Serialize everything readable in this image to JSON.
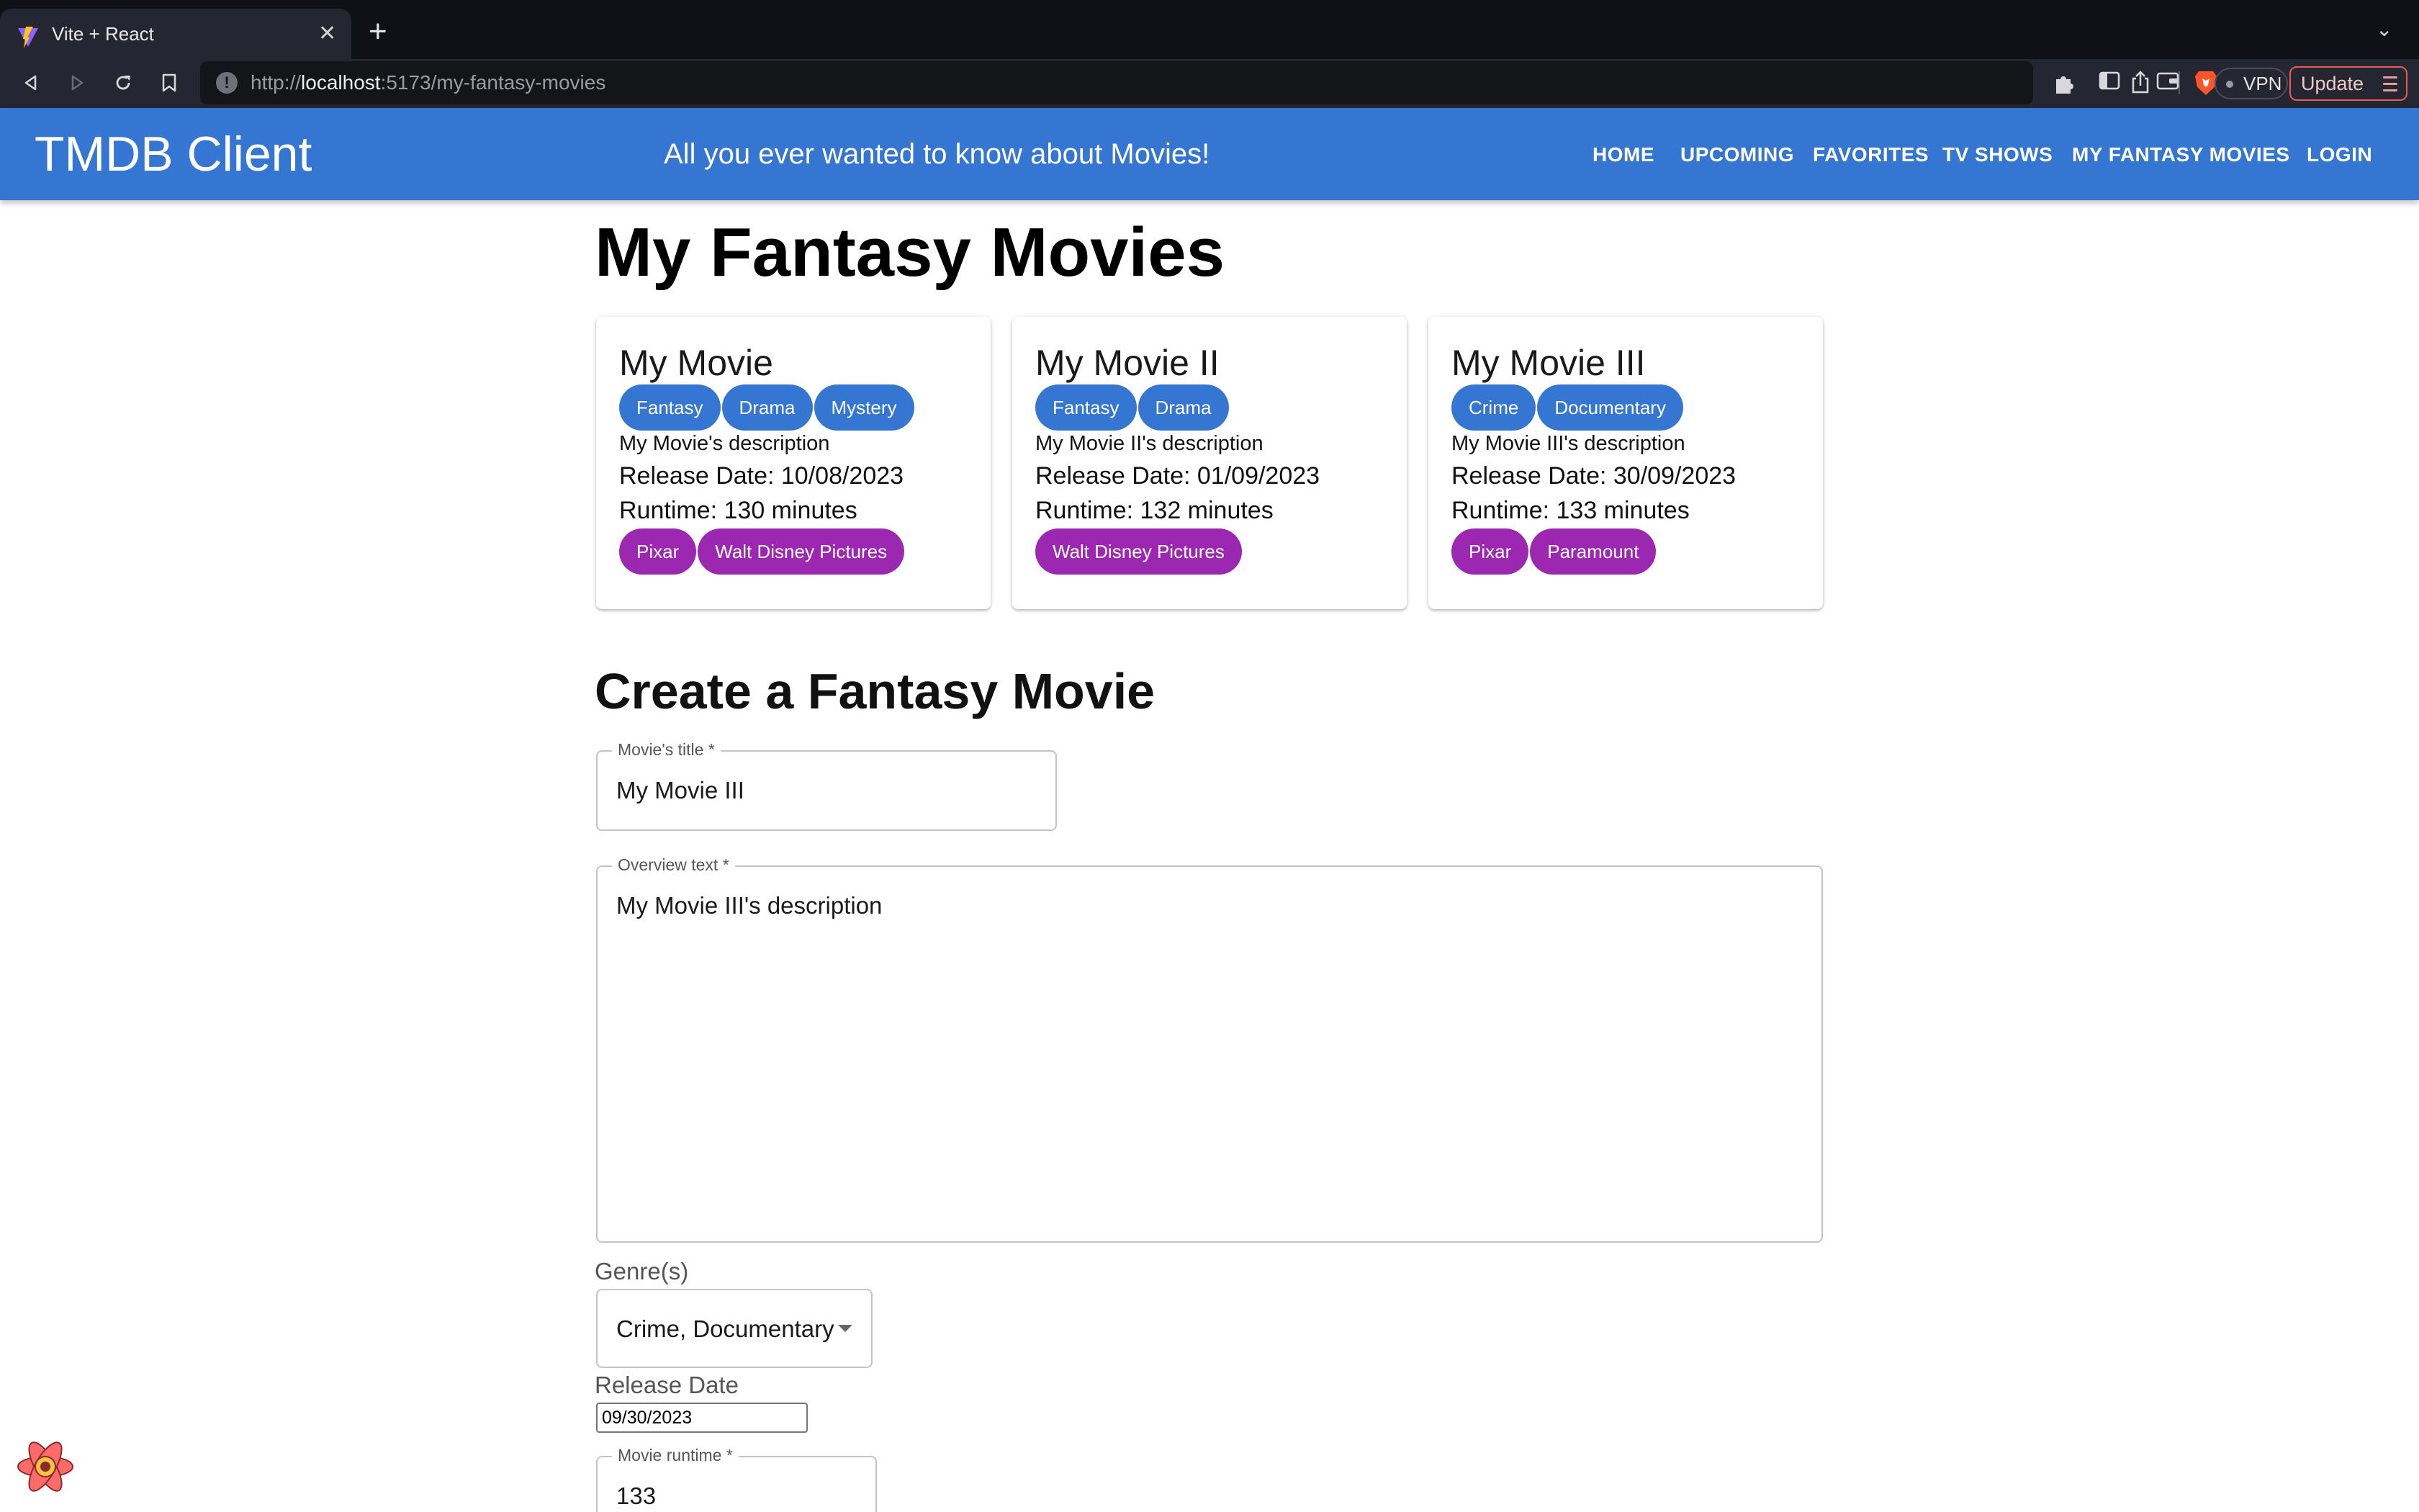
{
  "browser": {
    "tab_title": "Vite + React",
    "url_scheme": "http://",
    "url_host": "localhost",
    "url_path": ":5173/my-fantasy-movies",
    "vpn_label": "VPN",
    "update_label": "Update"
  },
  "header": {
    "brand": "TMDB Client",
    "tagline": "All you ever wanted to know about Movies!",
    "nav": [
      "HOME",
      "UPCOMING",
      "FAVORITES",
      "TV SHOWS",
      "MY FANTASY MOVIES",
      "LOGIN"
    ]
  },
  "page": {
    "title": "My Fantasy Movies"
  },
  "movies": [
    {
      "title": "My Movie",
      "genres": [
        "Fantasy",
        "Drama",
        "Mystery"
      ],
      "description": "My Movie's description",
      "release": "Release Date: 10/08/2023",
      "runtime": "Runtime: 130 minutes",
      "companies": [
        "Pixar",
        "Walt Disney Pictures"
      ]
    },
    {
      "title": "My Movie II",
      "genres": [
        "Fantasy",
        "Drama"
      ],
      "description": "My Movie II's description",
      "release": "Release Date: 01/09/2023",
      "runtime": "Runtime: 132 minutes",
      "companies": [
        "Walt Disney Pictures"
      ]
    },
    {
      "title": "My Movie III",
      "genres": [
        "Crime",
        "Documentary"
      ],
      "description": "My Movie III's description",
      "release": "Release Date: 30/09/2023",
      "runtime": "Runtime: 133 minutes",
      "companies": [
        "Pixar",
        "Paramount"
      ]
    }
  ],
  "form": {
    "section_title": "Create a Fantasy Movie",
    "title_label": "Movie's title *",
    "title_value": "My Movie III",
    "overview_label": "Overview text *",
    "overview_value": "My Movie III's description",
    "genres_label": "Genre(s)",
    "genres_value": "Crime, Documentary",
    "release_label": "Release Date",
    "release_value": "09/30/2023",
    "runtime_label": "Movie runtime *",
    "runtime_value": "133"
  },
  "colors": {
    "appbar": "#3476d2",
    "genre_chip": "#3476d2",
    "company_chip": "#9c27b0"
  }
}
